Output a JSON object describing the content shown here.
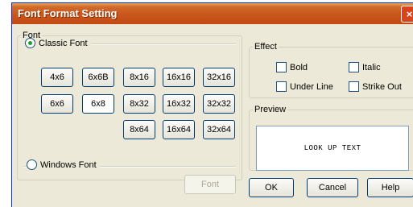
{
  "window": {
    "title": "Font Format Setting",
    "close_glyph": "×"
  },
  "font_group": {
    "legend": "Font",
    "classic_font_label": "Classic Font",
    "windows_font_label": "Windows Font",
    "font_button_label": "Font",
    "size_rows": [
      [
        "4x6",
        "6x6B",
        "8x16",
        "16x16",
        "32x16"
      ],
      [
        "6x6",
        "6x8",
        "8x32",
        "16x32",
        "32x32"
      ],
      [
        "8x64",
        "16x64",
        "32x64"
      ]
    ],
    "selected_size": "6x8"
  },
  "effect_group": {
    "legend": "Effect",
    "bold_label": "Bold",
    "italic_label": "Italic",
    "underline_label": "Under Line",
    "strikeout_label": "Strike Out"
  },
  "preview_group": {
    "legend": "Preview",
    "preview_text": "LOOK UP TEXT"
  },
  "buttons": {
    "ok": "OK",
    "cancel": "Cancel",
    "help": "Help"
  },
  "colors": {
    "titlebar_accent": "#c9561c",
    "dialog_face": "#ece9d8",
    "radio_dot": "#21a121"
  },
  "icons": {
    "close": "close-icon"
  }
}
